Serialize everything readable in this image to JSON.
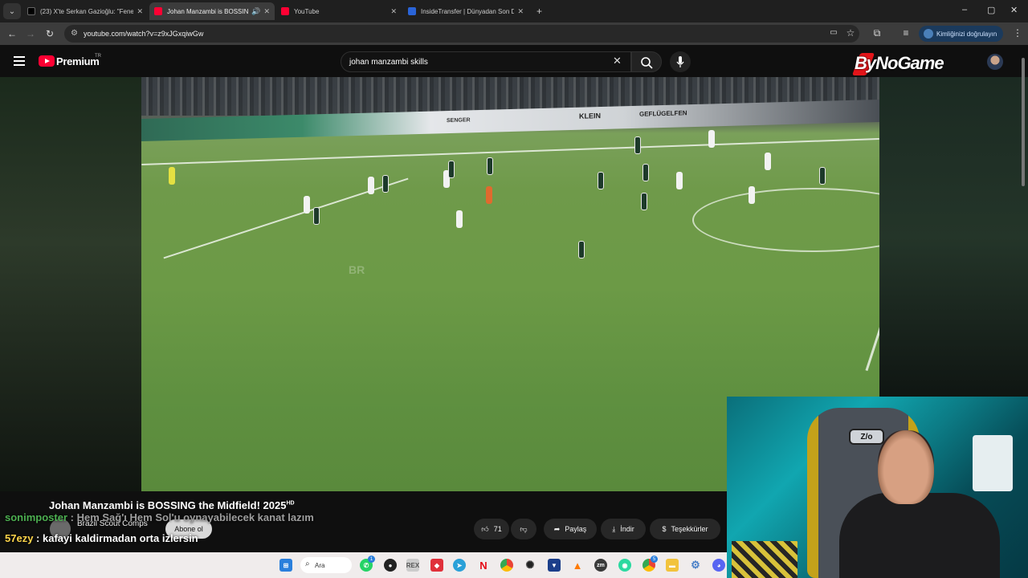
{
  "browser": {
    "tabs": [
      {
        "title": "(23) X'te Serkan Gazioğlu: \"Fenerb",
        "favicon": "x-icon",
        "active": false
      },
      {
        "title": "Johan Manzambi is BOSSING",
        "favicon": "youtube-icon",
        "active": true
      },
      {
        "title": "YouTube",
        "favicon": "youtube-icon",
        "active": false
      },
      {
        "title": "InsideTransfer | Dünyadan Son D",
        "favicon": "insidetransfer-icon",
        "active": false
      }
    ],
    "new_tab": "+",
    "url": "youtube.com/watch?v=z9xJGxqiwGw",
    "verify_label": "Kimliğinizi doğrulayın",
    "window_controls": [
      "–",
      "▢",
      "✕"
    ]
  },
  "youtube": {
    "logo_text": "Premium",
    "region": "TR",
    "search_query": "johan manzambi skills",
    "overlay_logo": "ByNoGame"
  },
  "video": {
    "title": "Johan Manzambi is BOSSING the Midfield! 2025",
    "quality_badge": "HD",
    "channel": "Brazil Scout Comps",
    "subscribe": "Abone ol",
    "watermark": "BR",
    "likes": "71",
    "share": "Paylaş",
    "download": "İndir",
    "thanks": "Teşekkürler",
    "ad_boards": [
      "SENGER",
      "KLEIN",
      "GEFLÜGELFEN"
    ]
  },
  "chat": [
    {
      "user": "sonimposter",
      "message": ": Hem Sağ'ı Hem Sol'u oynayabilecek kanat lazım"
    },
    {
      "user": "57ezy",
      "message": ": kafayi kaldirmadan orta izlersin"
    }
  ],
  "taskbar": {
    "search_label": "Ara",
    "icons": [
      "windows-icon",
      "whatsapp-icon",
      "app-icon",
      "rex-icon",
      "store-icon",
      "telegram-icon",
      "netflix-icon",
      "chrome-icon",
      "openai-icon",
      "vpn-icon",
      "vlc-icon",
      "zoom-icon",
      "app2-icon",
      "chrome-profile-icon",
      "explorer-icon",
      "settings-icon",
      "discord-icon"
    ],
    "badges": {
      "whatsapp": "1",
      "chrome_profile": "5"
    }
  },
  "colors": {
    "youtube_red": "#ff0033",
    "pitch_green": "#6c9a46",
    "chat_user1": "#4caf50",
    "chat_user2": "#ffd54a"
  }
}
